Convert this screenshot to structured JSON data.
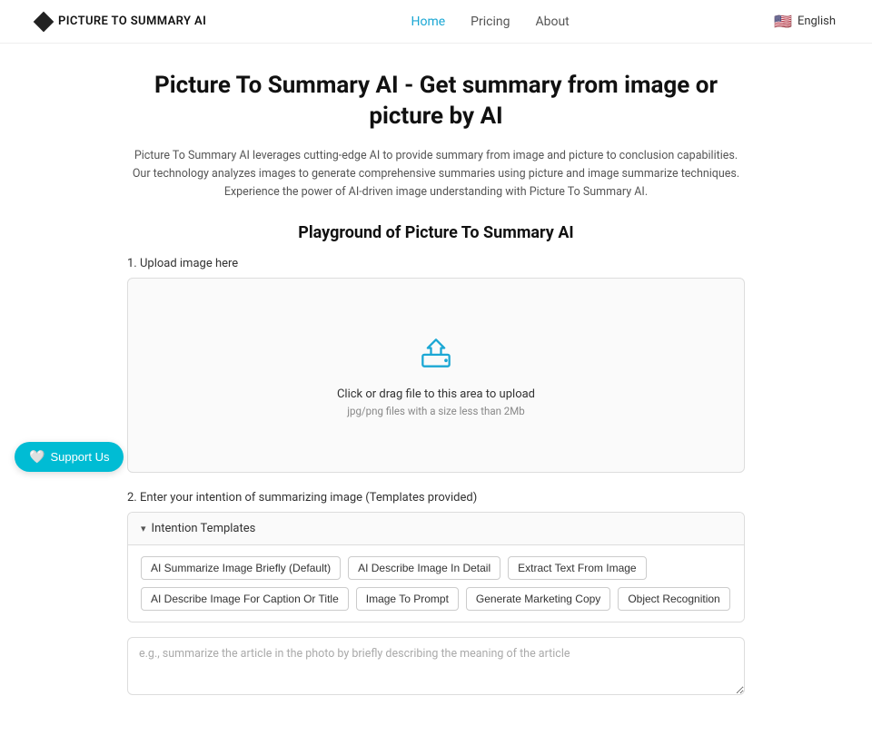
{
  "header": {
    "logo_text": "PICTURE TO SUMMARY AI",
    "nav": [
      {
        "label": "Home",
        "active": true
      },
      {
        "label": "Pricing",
        "active": false
      },
      {
        "label": "About",
        "active": false
      }
    ],
    "language": "English",
    "flag": "🇺🇸"
  },
  "hero": {
    "title": "Picture To Summary AI - Get summary from image or picture by AI",
    "description": "Picture To Summary AI leverages cutting-edge AI to provide summary from image and picture to conclusion capabilities. Our technology analyzes images to generate comprehensive summaries using picture and image summarize techniques. Experience the power of AI-driven image understanding with Picture To Summary AI."
  },
  "playground": {
    "title": "Playground of Picture To Summary AI",
    "upload_section_label": "1. Upload image here",
    "upload_main_text": "Click or drag file to this area to upload",
    "upload_sub_text": "jpg/png files with a size less than 2Mb",
    "intention_section_label": "2. Enter your intention of summarizing image (Templates provided)",
    "intention_header": "Intention Templates",
    "templates": [
      "AI Summarize Image Briefly (Default)",
      "AI Describe Image In Detail",
      "Extract Text From Image",
      "AI Describe Image For Caption Or Title",
      "Image To Prompt",
      "Generate Marketing Copy",
      "Object Recognition"
    ],
    "prompt_placeholder": "e.g., summarize the article in the photo by briefly describing the meaning of the article"
  },
  "support": {
    "label": "Support Us"
  }
}
